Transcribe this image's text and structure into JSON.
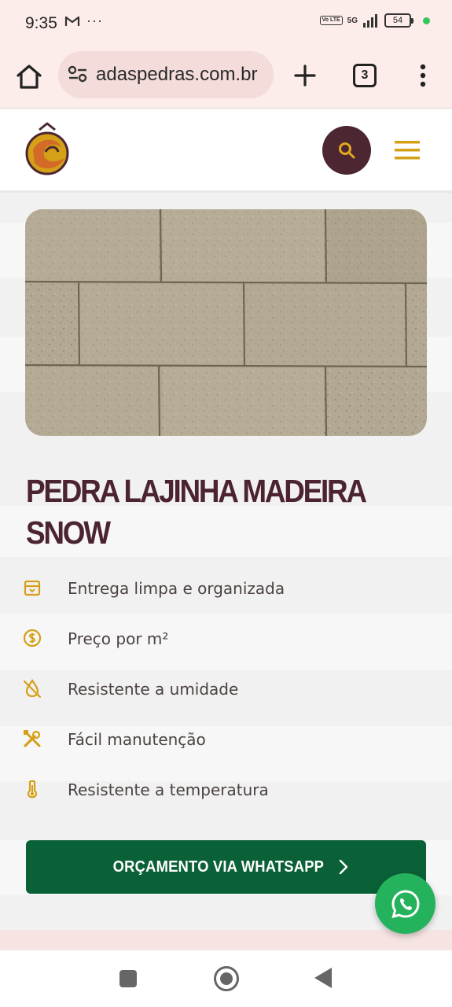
{
  "status_bar": {
    "time": "9:35",
    "dots": "···",
    "volte": "Vo LTE",
    "network": "5G",
    "battery": "54"
  },
  "browser": {
    "url": "adaspedras.com.br",
    "tab_count": "3"
  },
  "header": {
    "logo_icon": "lion-logo-icon",
    "search_icon": "search-icon",
    "menu_icon": "hamburger-icon"
  },
  "product": {
    "title": "PEDRA LAJINHA MADEIRA SNOW",
    "features": [
      {
        "icon": "box-icon",
        "label": "Entrega limpa e organizada"
      },
      {
        "icon": "dollar-icon",
        "label": "Preço por m²"
      },
      {
        "icon": "no-water-icon",
        "label": "Resistente a umidade"
      },
      {
        "icon": "tools-icon",
        "label": "Fácil manutenção"
      },
      {
        "icon": "thermometer-icon",
        "label": "Resistente a temperatura"
      }
    ],
    "cta_label": "ORÇAMENTO VIA WHATSAPP"
  },
  "colors": {
    "brand_dark": "#4c2631",
    "accent_gold": "#d4a017",
    "whatsapp_green": "#25b25d",
    "cta_green": "#0b6137"
  }
}
